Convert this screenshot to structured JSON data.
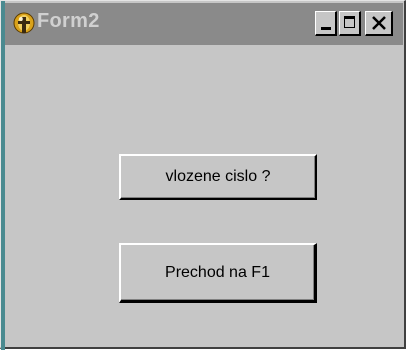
{
  "window": {
    "title": "Form2"
  },
  "title_buttons": {
    "minimize": "minimize-icon",
    "maximize": "maximize-icon",
    "close": "close-icon"
  },
  "buttons": {
    "input_number": "vlozene cislo ?",
    "go_to_f1": "Prechod na F1"
  },
  "colors": {
    "face": "#c6c6c6",
    "titlebar_inactive": "#8a8a8a",
    "title_text": "#d0d0d0"
  }
}
